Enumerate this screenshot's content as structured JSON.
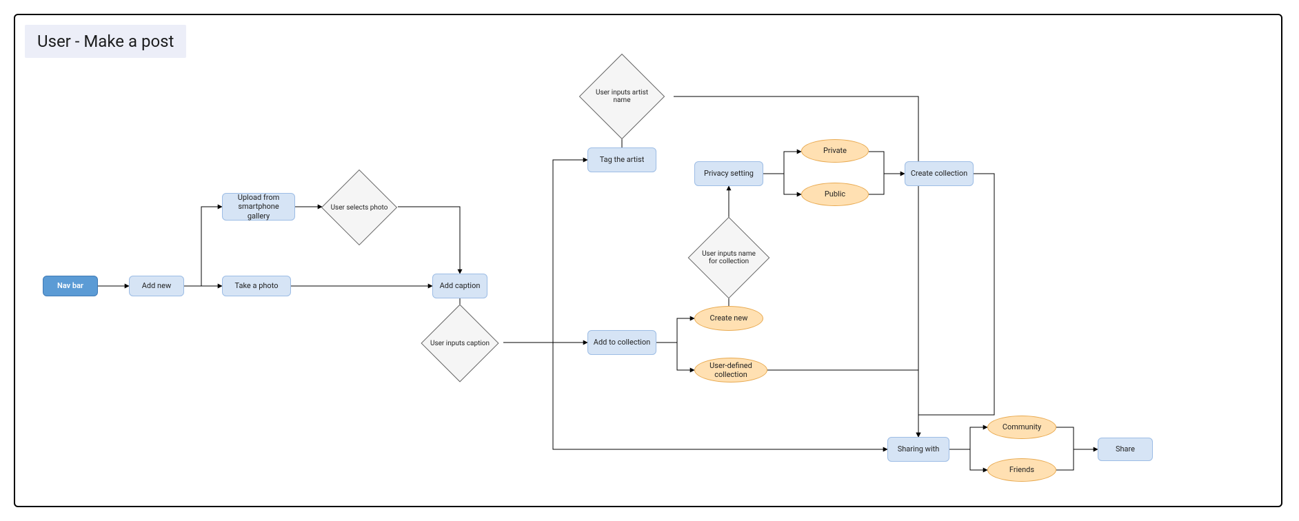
{
  "title": "User - Make a post",
  "nodes": {
    "nav_bar": "Nav bar",
    "add_new": "Add new",
    "upload_gallery": "Upload from smartphone gallery",
    "take_photo": "Take a photo",
    "selects_photo": "User selects photo",
    "add_caption": "Add caption",
    "inputs_caption": "User inputs caption",
    "tag_artist": "Tag the artist",
    "inputs_artist": "User inputs artist name",
    "add_collection": "Add to collection",
    "create_new": "Create new",
    "user_collection": "User-defined collection",
    "inputs_collection_name": "User inputs name for collection",
    "privacy_setting": "Privacy setting",
    "private": "Private",
    "public": "Public",
    "create_collection": "Create collection",
    "sharing_with": "Sharing with",
    "community": "Community",
    "friends": "Friends",
    "share": "Share"
  }
}
